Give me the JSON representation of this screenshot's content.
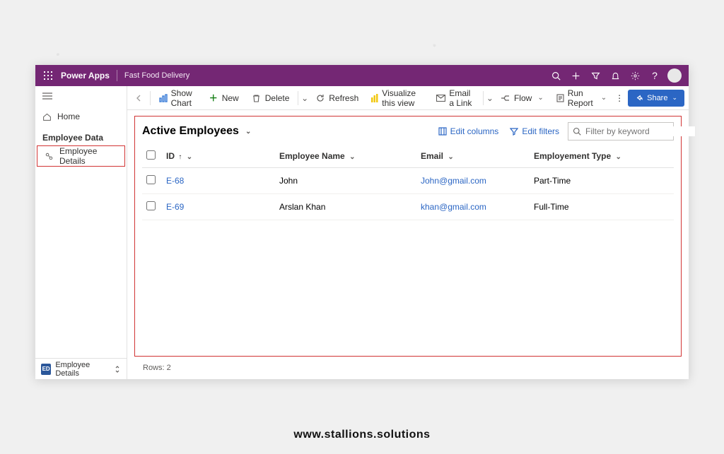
{
  "header": {
    "app": "Power Apps",
    "environment": "Fast Food Delivery"
  },
  "sidebar": {
    "home": "Home",
    "section": "Employee Data",
    "items": [
      "Employee Details"
    ],
    "bottom_badge": "ED",
    "bottom_label": "Employee Details"
  },
  "commands": {
    "back": "Back",
    "show_chart": "Show Chart",
    "new": "New",
    "delete": "Delete",
    "refresh": "Refresh",
    "visualize": "Visualize this view",
    "email_link": "Email a Link",
    "flow": "Flow",
    "run_report": "Run Report",
    "share": "Share"
  },
  "view": {
    "title": "Active Employees",
    "edit_columns": "Edit columns",
    "edit_filters": "Edit filters",
    "filter_placeholder": "Filter by keyword"
  },
  "table": {
    "columns": [
      "ID",
      "Employee Name",
      "Email",
      "Employement Type"
    ],
    "sort_column": "ID",
    "sort_dir": "asc",
    "rows": [
      {
        "id": "E-68",
        "name": "John",
        "email": "John@gmail.com",
        "type": "Part-Time"
      },
      {
        "id": "E-69",
        "name": "Arslan Khan",
        "email": "khan@gmail.com",
        "type": "Full-Time"
      }
    ],
    "row_count_label": "Rows: 2"
  },
  "caption": "www.stallions.solutions",
  "colors": {
    "brand": "#742774",
    "accent": "#2b66c4",
    "highlight": "#d13434"
  }
}
